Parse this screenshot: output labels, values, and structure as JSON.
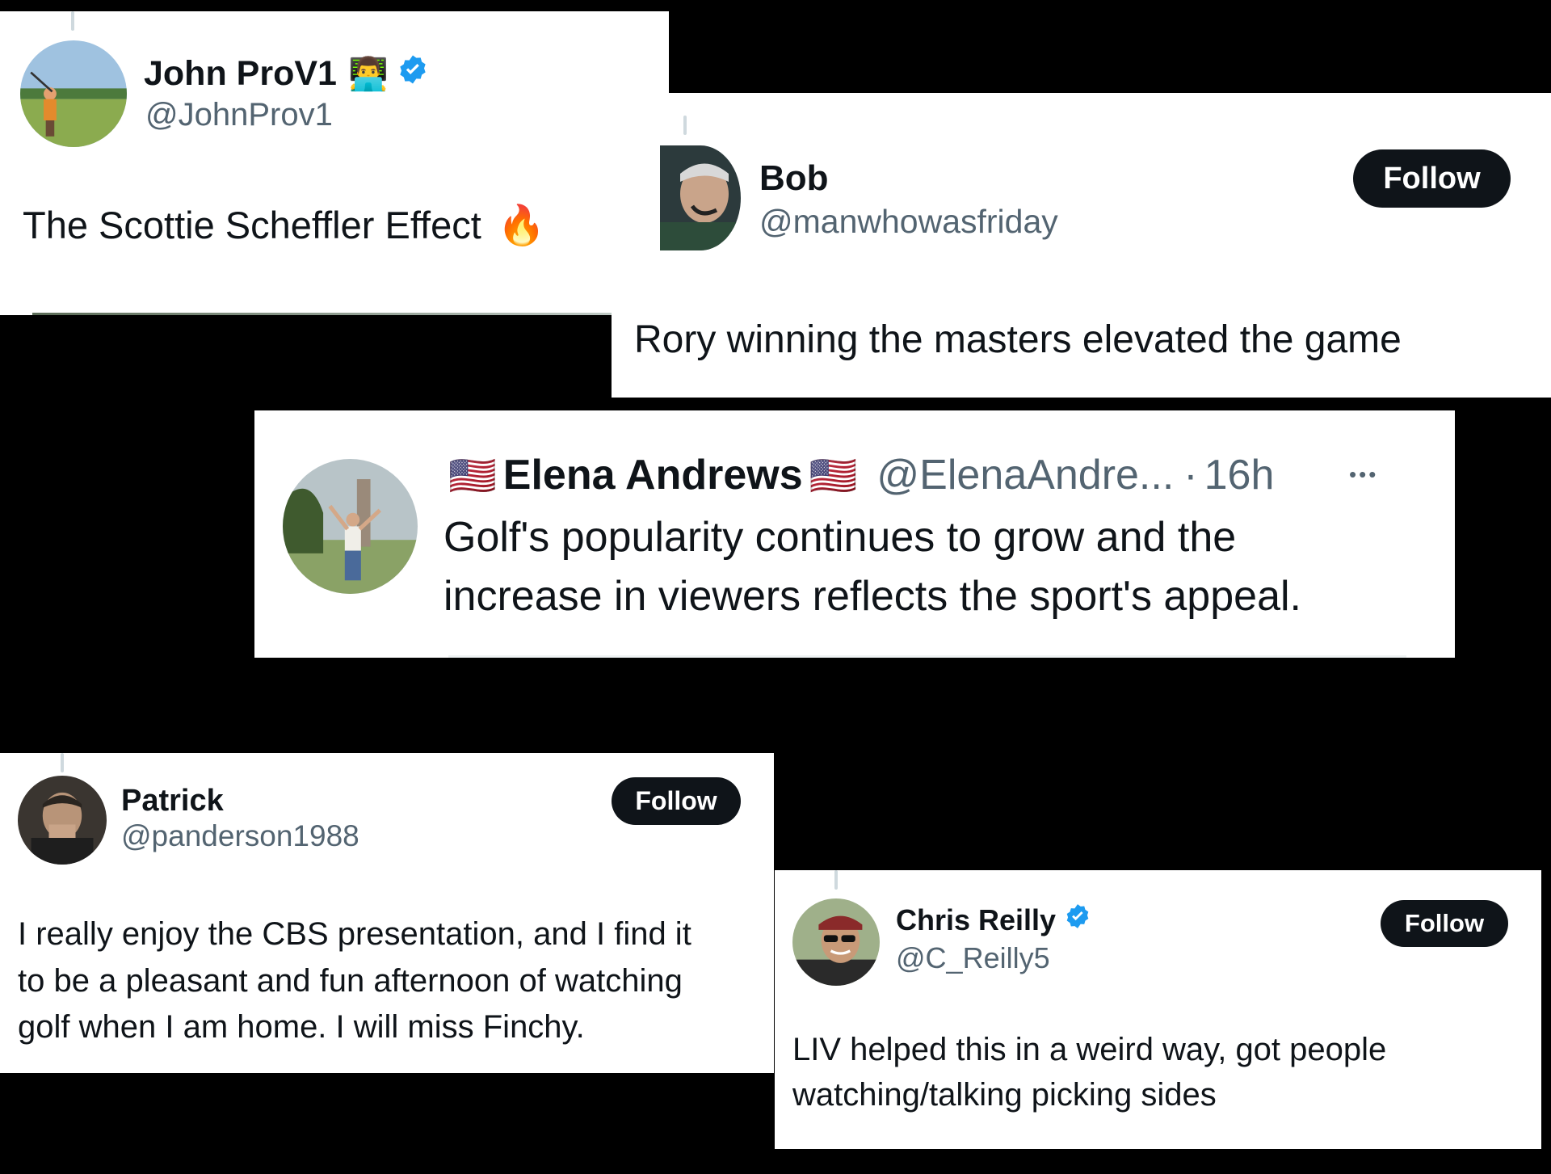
{
  "tweets": {
    "john": {
      "name": "John ProV1",
      "name_emoji": "👨‍💻",
      "handle": "@JohnProv1",
      "text": "The Scottie Scheffler Effect",
      "text_emoji": "🔥",
      "verified": true
    },
    "bob": {
      "name": "Bob",
      "handle": "@manwhowasfriday",
      "text": "Rory winning the masters elevated the game",
      "follow_label": "Follow"
    },
    "elena": {
      "flag_left": "🇺🇸",
      "name": "Elena Andrews",
      "flag_right": "🇺🇸",
      "handle": "@ElenaAndre...",
      "separator": "·",
      "time": "16h",
      "more": "•••",
      "text_line1": "Golf's popularity continues to grow and the",
      "text_line2": "increase in viewers reflects the sport's appeal."
    },
    "patrick": {
      "name": "Patrick",
      "handle": "@panderson1988",
      "text_line1": "I really enjoy the CBS presentation, and I find it",
      "text_line2": "to be a pleasant and fun afternoon of watching",
      "text_line3": "golf when I am home. I will miss Finchy.",
      "follow_label": "Follow"
    },
    "chris": {
      "name": "Chris Reilly",
      "handle": "@C_Reilly5",
      "text_line1": "LIV helped this in a weird way, got people",
      "text_line2": "watching/talking picking sides",
      "follow_label": "Follow",
      "verified": true
    }
  },
  "colors": {
    "background": "#000000",
    "card": "#ffffff",
    "verified_blue": "#1d9bf0",
    "follow_bg": "#0f1419",
    "handle_gray": "#536471"
  }
}
